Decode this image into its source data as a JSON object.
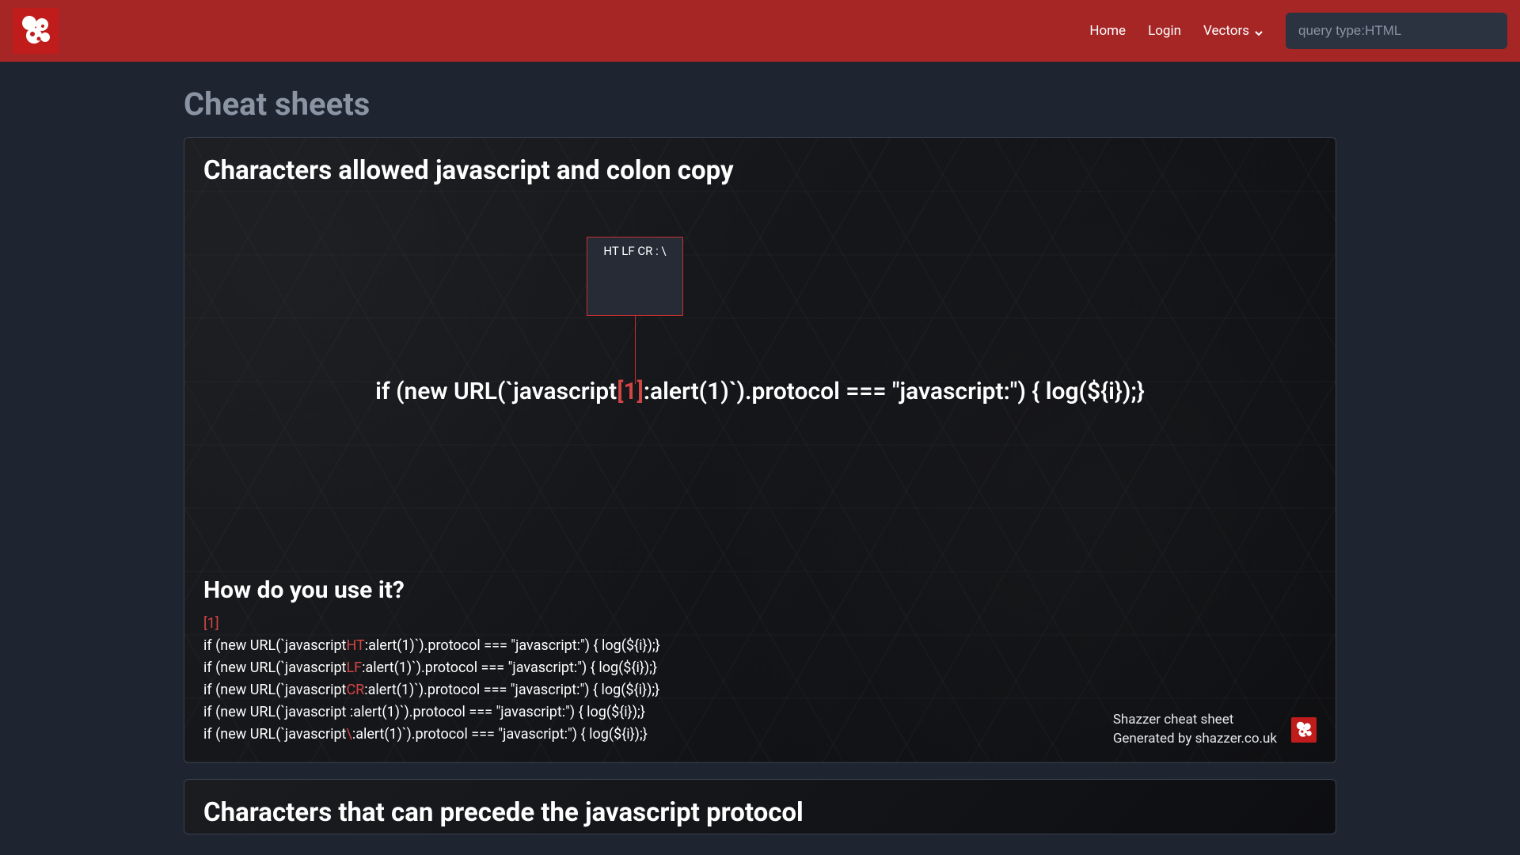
{
  "nav": {
    "home": "Home",
    "login": "Login",
    "vectors": "Vectors"
  },
  "search": {
    "placeholder": "query type:HTML"
  },
  "page_title": "Cheat sheets",
  "card1": {
    "title": "Characters allowed javascript and colon copy",
    "tooltip": "HT LF CR : \\",
    "code_pre": "if (new URL(`javascript",
    "code_token": "[1]",
    "code_post": ":alert(1)`).protocol === \"javascript:\") { log(${i});}",
    "howto_title": "How do you use it?",
    "example_marker": "[1]",
    "examples": [
      {
        "pre": "if (new URL(`javascript",
        "tok": "HT",
        "post": ":alert(1)`).protocol === \"javascript:\") { log(${i});}"
      },
      {
        "pre": "if (new URL(`javascript",
        "tok": "LF",
        "post": ":alert(1)`).protocol === \"javascript:\") { log(${i});}"
      },
      {
        "pre": "if (new URL(`javascript",
        "tok": "CR",
        "post": ":alert(1)`).protocol === \"javascript:\") { log(${i});}"
      },
      {
        "pre": "if (new URL(`javascript ",
        "tok": "",
        "post": ":alert(1)`).protocol === \"javascript:\") { log(${i});}"
      },
      {
        "pre": "if (new URL(`javascript",
        "tok": "\\",
        "post": ":alert(1)`).protocol === \"javascript:\") { log(${i});}"
      }
    ],
    "footer_line1": "Shazzer cheat sheet",
    "footer_line2": "Generated by shazzer.co.uk"
  },
  "card2": {
    "title": "Characters that can precede the javascript protocol"
  }
}
